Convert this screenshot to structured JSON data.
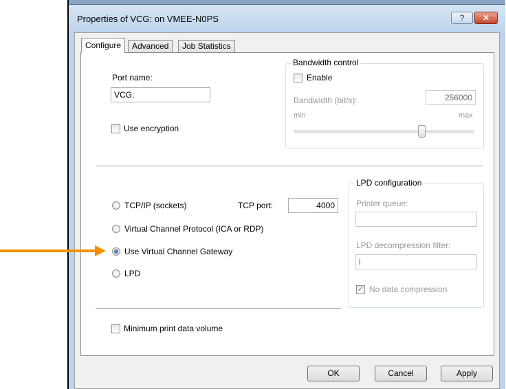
{
  "window": {
    "title": "Properties of VCG: on VMEE-N0PS",
    "help_glyph": "?",
    "close_glyph": "✕"
  },
  "tabs": [
    {
      "label": "Configure",
      "active": true
    },
    {
      "label": "Advanced",
      "active": false
    },
    {
      "label": "Job Statistics",
      "active": false
    }
  ],
  "port": {
    "label": "Port name:",
    "value": "VCG:"
  },
  "encryption": {
    "label": "Use encryption",
    "checked": false
  },
  "bandwidth": {
    "group_title": "Bandwidth control",
    "enable_label": "Enable",
    "enable_checked": false,
    "bandwidth_label": "Bandwidth (bit/s):",
    "bandwidth_value": "256000",
    "min_label": "min",
    "max_label": "max"
  },
  "connection": {
    "tcpip_label": "TCP/IP (sockets)",
    "tcp_port_label": "TCP port:",
    "tcp_port_value": "4000",
    "vcp_label": "Virtual Channel Protocol (ICA or RDP)",
    "vcg_label": "Use Virtual Channel Gateway",
    "lpd_label": "LPD",
    "selected": "vcg"
  },
  "lpd_config": {
    "group_title": "LPD configuration",
    "printer_queue_label": "Printer queue:",
    "printer_queue_value": "",
    "decompression_label": "LPD decompression filter:",
    "decompression_value": "l",
    "no_compression_label": "No data compression",
    "no_compression_checked": true,
    "check_glyph": "✓"
  },
  "minimum_print": {
    "label": "Minimum print data volume",
    "checked": false
  },
  "buttons": {
    "ok": "OK",
    "cancel": "Cancel",
    "apply": "Apply"
  },
  "colors": {
    "arrow": "#f39200",
    "titlebar": "#bcd3ec",
    "close_button": "#c7452b"
  }
}
